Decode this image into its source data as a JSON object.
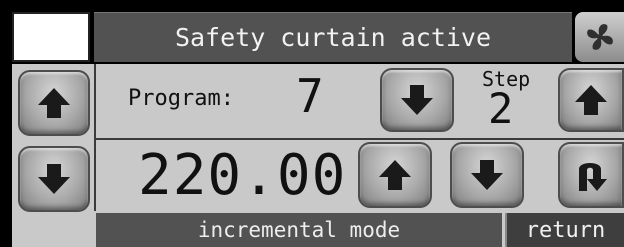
{
  "header": {
    "title": "Safety curtain active",
    "fan_icon": "fan-icon"
  },
  "program": {
    "label": "Program:",
    "value": "7"
  },
  "step": {
    "label": "Step",
    "value": "2"
  },
  "setpoint": {
    "value": "220.00"
  },
  "footer": {
    "mode": "incremental mode",
    "return_label": "return"
  },
  "icons": {
    "up": "arrow-up-icon",
    "down": "arrow-down-icon",
    "return": "return-arrow-icon"
  }
}
